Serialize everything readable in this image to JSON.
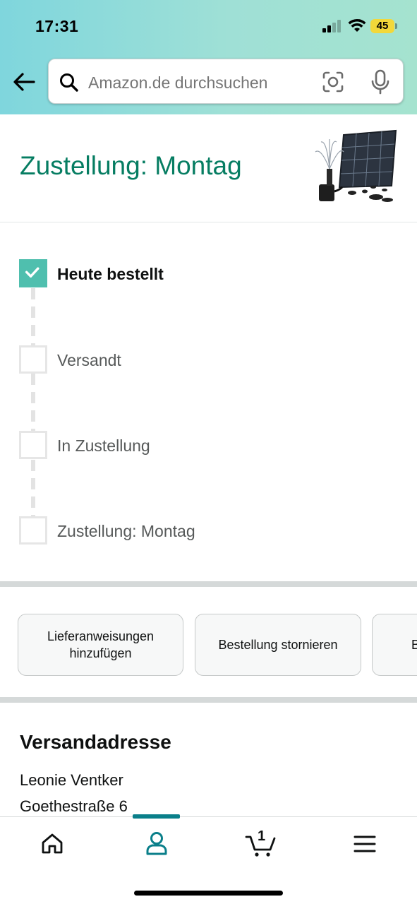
{
  "status_bar": {
    "time": "17:31",
    "battery": "45"
  },
  "search": {
    "placeholder": "Amazon.de durchsuchen"
  },
  "delivery": {
    "title": "Zustellung: Montag"
  },
  "tracker": {
    "steps": [
      {
        "label": "Heute bestellt",
        "done": true
      },
      {
        "label": "Versandt",
        "done": false
      },
      {
        "label": "In Zustellung",
        "done": false
      },
      {
        "label": "Zustellung: Montag",
        "done": false
      }
    ]
  },
  "actions": {
    "add_instructions": "Lieferanweisungen hinzufügen",
    "cancel_order": "Bestellung stornieren",
    "partial_third": "B"
  },
  "address": {
    "heading": "Versandadresse",
    "name": "Leonie Ventker",
    "street": "Goethestraße 6"
  },
  "bottom_nav": {
    "cart_count": "1"
  },
  "colors": {
    "accent_green": "#067d62",
    "check_teal": "#4fbfae",
    "nav_active": "#0a7f8a"
  }
}
